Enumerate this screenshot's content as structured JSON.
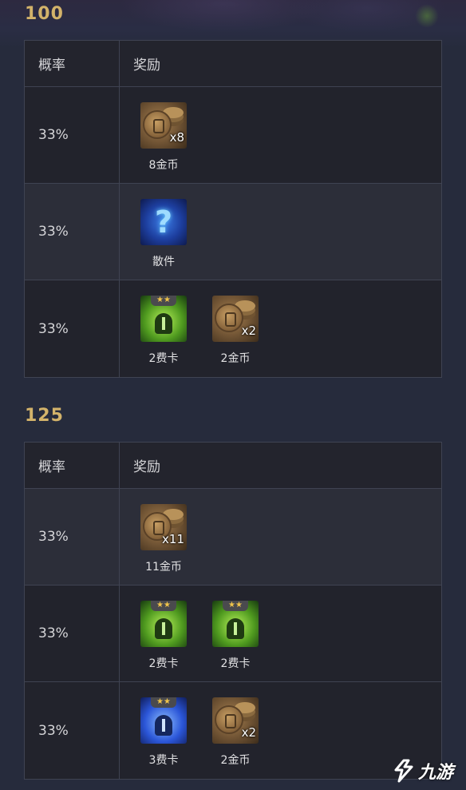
{
  "sections": [
    {
      "title": "100",
      "header": {
        "probability": "概率",
        "reward": "奖励"
      },
      "rows": [
        {
          "probability": "33%",
          "rewards": [
            {
              "icon": "gold-coin-icon",
              "qty": "x8",
              "label": "8金币"
            }
          ]
        },
        {
          "probability": "33%",
          "rewards": [
            {
              "icon": "item-component-icon",
              "label": "散件"
            }
          ]
        },
        {
          "probability": "33%",
          "rewards": [
            {
              "icon": "champion-2-cost-icon",
              "stars": "★★",
              "label": "2费卡"
            },
            {
              "icon": "gold-coin-icon",
              "qty": "x2",
              "label": "2金币"
            }
          ]
        }
      ]
    },
    {
      "title": "125",
      "header": {
        "probability": "概率",
        "reward": "奖励"
      },
      "rows": [
        {
          "probability": "33%",
          "rewards": [
            {
              "icon": "gold-coin-icon",
              "qty": "x11",
              "label": "11金币"
            }
          ]
        },
        {
          "probability": "33%",
          "rewards": [
            {
              "icon": "champion-2-cost-icon",
              "stars": "★★",
              "label": "2费卡"
            },
            {
              "icon": "champion-2-cost-icon",
              "stars": "★★",
              "label": "2费卡"
            }
          ]
        },
        {
          "probability": "33%",
          "rewards": [
            {
              "icon": "champion-3-cost-icon",
              "stars": "★★",
              "label": "3费卡"
            },
            {
              "icon": "gold-coin-icon",
              "qty": "x2",
              "label": "2金币"
            }
          ]
        }
      ]
    }
  ],
  "watermark": {
    "text": "九游"
  },
  "colors": {
    "background": "#262b3c",
    "title": "#d3b36a",
    "table_border": "#3f4352",
    "row": "#22232c",
    "row_alt": "#2c2e39"
  }
}
